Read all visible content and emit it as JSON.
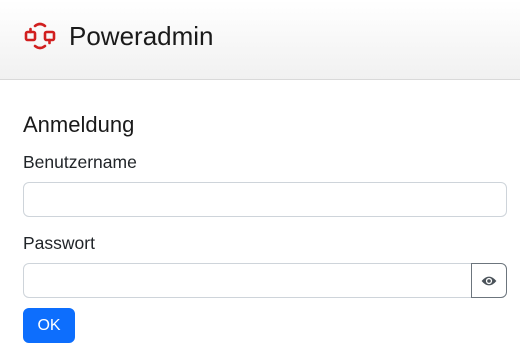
{
  "header": {
    "brand_name": "Poweradmin",
    "logo_icon": "poweradmin-logo-icon",
    "logo_color": "#d11f1f"
  },
  "login": {
    "title": "Anmeldung",
    "username_label": "Benutzername",
    "username_value": "",
    "password_label": "Passwort",
    "password_value": "",
    "toggle_icon": "eye-icon",
    "submit_label": "OK"
  },
  "colors": {
    "primary": "#0d6efd",
    "navbar_bg": "#f8f8f8"
  }
}
